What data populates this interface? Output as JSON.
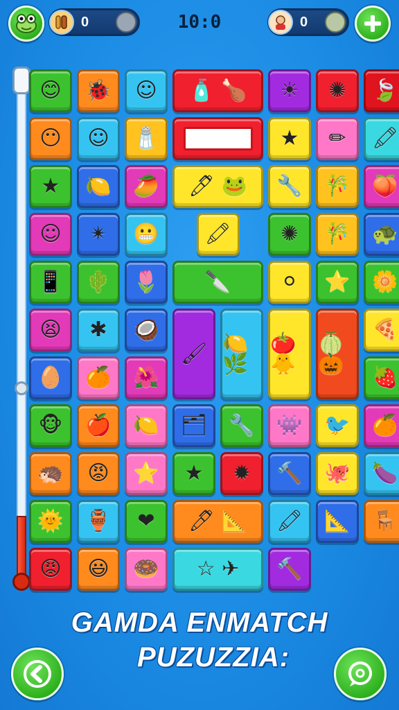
{
  "header": {
    "left_counter": {
      "value": "0",
      "avatar_icon": "food-avatar-icon"
    },
    "timer": "10:0",
    "right_counter": {
      "value": "0",
      "avatar_icon": "player-avatar-icon"
    }
  },
  "progress": {
    "fill_fraction": 0.13
  },
  "title": {
    "line1": "GAMDA  ENMATCH",
    "line2": "PUZUZZIA:"
  },
  "colors": {
    "green": "#3cc22e",
    "orange": "#ff8a1e",
    "sky": "#35c4f2",
    "red": "#f0202e",
    "purple": "#a22be0",
    "yellow": "#ffe62a",
    "pink": "#ff78c8",
    "blue": "#2f6ee8",
    "magenta": "#e23ab8",
    "teal": "#3ad8e0",
    "lime": "#8bde2a"
  },
  "tiles": [
    {
      "icon": "😊",
      "color": "#3cc22e"
    },
    {
      "icon": "🐞",
      "color": "#ff8a1e"
    },
    {
      "icon": "☺",
      "color": "#35c4f2"
    },
    {
      "icon": "🧴  🍗",
      "color": "#f0202e"
    },
    {
      "icon": "☀",
      "color": "#a22be0"
    },
    {
      "icon": "✺",
      "color": "#f0202e"
    },
    {
      "icon": "🍃",
      "color": "#e0141e"
    },
    {
      "icon": "😶",
      "color": "#ff8a1e"
    },
    {
      "icon": "☺",
      "color": "#35c4f2"
    },
    {
      "icon": "🧂",
      "color": "#ffc21e"
    },
    {
      "icon": "",
      "color": "#f0202e",
      "bar": true
    },
    {
      "icon": "★",
      "color": "#ffe62a"
    },
    {
      "icon": "✏",
      "color": "#ff78c8"
    },
    {
      "icon": "🖍",
      "color": "#3ad8e0"
    },
    {
      "icon": "★",
      "color": "#3cc22e"
    },
    {
      "icon": "🍋",
      "color": "#2f6ee8"
    },
    {
      "icon": "🥭",
      "color": "#e23ab8"
    },
    {
      "icon": "🖊  🐸",
      "color": "#ffe62a"
    },
    {
      "icon": "🔧",
      "color": "#ffe62a"
    },
    {
      "icon": "🎋",
      "color": "#ffc21e"
    },
    {
      "icon": "🍑",
      "color": "#e23ab8"
    },
    {
      "icon": "☺",
      "color": "#e23ab8"
    },
    {
      "icon": "✴",
      "color": "#2f6ee8"
    },
    {
      "icon": "😬",
      "color": "#35c4f2"
    },
    {
      "icon": "🖍",
      "color": "#ffe62a"
    },
    {
      "icon": "✺",
      "color": "#3cc22e"
    },
    {
      "icon": "🎋",
      "color": "#ffc21e"
    },
    {
      "icon": "🐢",
      "color": "#2f6ee8"
    },
    {
      "icon": "📱",
      "color": "#3cc22e"
    },
    {
      "icon": "🌵",
      "color": "#3cc22e"
    },
    {
      "icon": "🌷",
      "color": "#2f6ee8"
    },
    {
      "icon": "🔪",
      "color": "#3cc22e"
    },
    {
      "icon": "⚪",
      "color": "#ffe62a"
    },
    {
      "icon": "⭐",
      "color": "#3cc22e"
    },
    {
      "icon": "🌼",
      "color": "#3cc22e"
    },
    {
      "icon": "😫",
      "color": "#e23ab8"
    },
    {
      "icon": "✱",
      "color": "#35c4f2"
    },
    {
      "icon": "🥥",
      "color": "#2f6ee8"
    },
    {
      "icon": "🖌",
      "color": "#a22be0"
    },
    {
      "icon": "🍋  🌿",
      "color": "#35c4f2"
    },
    {
      "icon": "🍅  🐥",
      "color": "#ffe62a"
    },
    {
      "icon": "🍈  🎃",
      "color": "#f04a1e"
    },
    {
      "icon": "🍕",
      "color": "#ffe62a"
    },
    {
      "icon": "🥚",
      "color": "#2f6ee8"
    },
    {
      "icon": "🍊",
      "color": "#ff78c8"
    },
    {
      "icon": "🌺",
      "color": "#e23ab8"
    },
    {
      "icon": "🍓",
      "color": "#3cc22e"
    },
    {
      "icon": "🐵",
      "color": "#3cc22e"
    },
    {
      "icon": "🍎",
      "color": "#ff8a1e"
    },
    {
      "icon": "🍋",
      "color": "#ff78c8"
    },
    {
      "icon": "🗂",
      "color": "#2f6ee8"
    },
    {
      "icon": "🔧",
      "color": "#3cc22e"
    },
    {
      "icon": "👾",
      "color": "#ff78c8"
    },
    {
      "icon": "🐦",
      "color": "#ffe62a"
    },
    {
      "icon": "🍊",
      "color": "#e23ab8"
    },
    {
      "icon": "🦔",
      "color": "#ff8a1e"
    },
    {
      "icon": "😡",
      "color": "#ff8a1e"
    },
    {
      "icon": "⭐",
      "color": "#ff78c8"
    },
    {
      "icon": "★",
      "color": "#3cc22e"
    },
    {
      "icon": "✹",
      "color": "#f0202e"
    },
    {
      "icon": "🔨",
      "color": "#2f6ee8"
    },
    {
      "icon": "🐙",
      "color": "#ffe62a"
    },
    {
      "icon": "🍆",
      "color": "#35c4f2"
    },
    {
      "icon": "🌞",
      "color": "#3cc22e"
    },
    {
      "icon": "🏺",
      "color": "#35c4f2"
    },
    {
      "icon": "❤",
      "color": "#3cc22e"
    },
    {
      "icon": "🖊  📐",
      "color": "#ff8a1e"
    },
    {
      "icon": "🖍",
      "color": "#35c4f2"
    },
    {
      "icon": "📐",
      "color": "#2f6ee8"
    },
    {
      "icon": "🪑",
      "color": "#ff8a1e"
    },
    {
      "icon": "😡",
      "color": "#f0202e"
    },
    {
      "icon": "😃",
      "color": "#ff8a1e"
    },
    {
      "icon": "🍩",
      "color": "#ff78c8"
    },
    {
      "icon": "☆  ✈",
      "color": "#3ad8e0"
    },
    {
      "icon": "🔨",
      "color": "#a22be0"
    }
  ],
  "footer": {
    "back_icon": "back-arrow-icon",
    "hint_icon": "chat-hint-icon"
  }
}
